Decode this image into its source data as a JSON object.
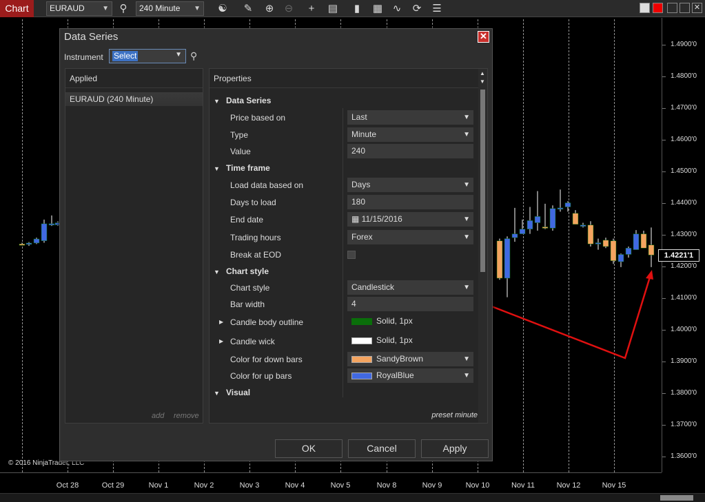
{
  "toolbar": {
    "chart_tab": "Chart",
    "instrument": "EURAUD",
    "interval": "240 Minute"
  },
  "price_axis": {
    "ticks": [
      "1.4900'0",
      "1.4800'0",
      "1.4700'0",
      "1.4600'0",
      "1.4500'0",
      "1.4400'0",
      "1.4300'0",
      "1.4200'0",
      "1.4100'0",
      "1.4000'0",
      "1.3900'0",
      "1.3800'0",
      "1.3700'0",
      "1.3600'0"
    ],
    "current_price": "1.4221'1"
  },
  "time_axis": {
    "ticks": [
      "Oct 28",
      "Oct 29",
      "Nov 1",
      "Nov 2",
      "Nov 3",
      "Nov 4",
      "Nov 5",
      "Nov 8",
      "Nov 9",
      "Nov 10",
      "Nov 11",
      "Nov 12",
      "Nov 15"
    ]
  },
  "copyright": "© 2016 NinjaTrader, LLC",
  "colors": {
    "up_bar": "#4169E1",
    "down_bar": "#F4A460",
    "wick": "#ffffff",
    "arrow": "#e01010",
    "chart_tab": "#9b1c1c"
  },
  "dialog": {
    "title": "Data Series",
    "instrument_label": "Instrument",
    "instrument_value": "Select",
    "applied_header": "Applied",
    "applied_item": "EURAUD (240 Minute)",
    "add_link": "add",
    "remove_link": "remove",
    "properties_header": "Properties",
    "categories": {
      "data_series": "Data Series",
      "time_frame": "Time frame",
      "chart_style": "Chart style",
      "visual": "Visual"
    },
    "props": {
      "price_based_on": {
        "label": "Price based on",
        "value": "Last"
      },
      "type": {
        "label": "Type",
        "value": "Minute"
      },
      "value": {
        "label": "Value",
        "value": "240"
      },
      "load_data_based_on": {
        "label": "Load data based on",
        "value": "Days"
      },
      "days_to_load": {
        "label": "Days to load",
        "value": "180"
      },
      "end_date": {
        "label": "End date",
        "value": "11/15/2016"
      },
      "trading_hours": {
        "label": "Trading hours",
        "value": "Forex"
      },
      "break_at_eod": {
        "label": "Break at EOD"
      },
      "chart_style": {
        "label": "Chart style",
        "value": "Candlestick"
      },
      "bar_width": {
        "label": "Bar width",
        "value": "4"
      },
      "candle_body_outline": {
        "label": "Candle body outline",
        "value": "Solid, 1px",
        "color": "#0a6e0a"
      },
      "candle_wick": {
        "label": "Candle wick",
        "value": "Solid, 1px",
        "color": "#ffffff"
      },
      "color_down_bars": {
        "label": "Color for down bars",
        "value": "SandyBrown",
        "color": "#F4A460"
      },
      "color_up_bars": {
        "label": "Color for up bars",
        "value": "RoyalBlue",
        "color": "#4169E1"
      }
    },
    "preset_link": "preset minute",
    "ok": "OK",
    "cancel": "Cancel",
    "apply": "Apply"
  }
}
